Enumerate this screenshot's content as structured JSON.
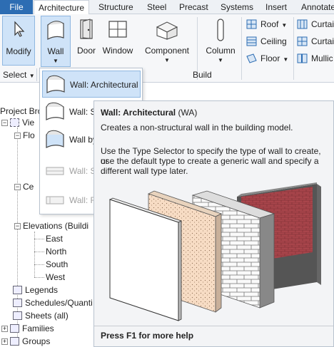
{
  "tabs": [
    "File",
    "Architecture",
    "Structure",
    "Steel",
    "Precast",
    "Systems",
    "Insert",
    "Annotate"
  ],
  "ribbon": {
    "modify_label": "Modify",
    "wall_label": "Wall",
    "door_label": "Door",
    "window_label": "Window",
    "component_label": "Component",
    "column_label": "Column",
    "roof_label": "Roof",
    "ceiling_label": "Ceiling",
    "floor_label": "Floor",
    "curtain1_label": "Curtai",
    "curtain2_label": "Curtai",
    "mullion_label": "Mullic",
    "select_label": "Select",
    "build_label": "Build"
  },
  "wall_menu": {
    "items": [
      "Wall: Architectural",
      "Wall: St",
      "Wall by",
      "Wall: Su",
      "Wall: R"
    ]
  },
  "browser": {
    "title": "Project Bro",
    "views": "Vie",
    "floor": "Flo",
    "ceiling": "Ce",
    "elevations": "Elevations (Buildi",
    "east": "East",
    "north": "North",
    "south": "South",
    "west": "West",
    "legends": "Legends",
    "schedules": "Schedules/Quanti",
    "sheets": "Sheets (all)",
    "families": "Families",
    "groups": "Groups"
  },
  "tooltip": {
    "title": "Wall: Architectural",
    "abbr": "(WA)",
    "line1": "Creates a non-structural wall in the building model.",
    "para2_l1": "Use the Type Selector to specify the type of wall to create, or",
    "para2_l2": "use the default type to create a generic wall and specify a",
    "para2_l3": "different wall type later.",
    "footer": "Press F1 for more help"
  },
  "colors": {
    "accent": "#2d6db3",
    "highlight": "#cfe3f8",
    "brick": "#a8454b",
    "plaster": "#f7dcc4"
  }
}
